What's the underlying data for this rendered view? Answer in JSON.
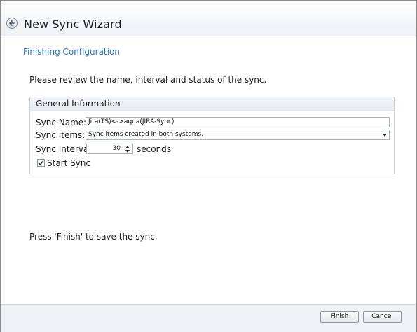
{
  "wizard": {
    "title": "New Sync Wizard",
    "subtitle": "Finishing Configuration",
    "instructions": "Please review the name, interval and status of the sync.",
    "finish_hint": "Press 'Finish' to save the sync."
  },
  "group": {
    "title": "General Information",
    "sync_name_label": "Sync Name:",
    "sync_name_value": "Jira(TS)<->aqua(JIRA-Sync)",
    "sync_items_label": "Sync Items:",
    "sync_items_value": "Sync items created in both systems.",
    "sync_interval_label": "Sync Interval:",
    "sync_interval_value": "30",
    "sync_interval_unit": "seconds",
    "start_sync_label": "Start Sync",
    "start_sync_checked": true
  },
  "footer": {
    "finish_label": "Finish",
    "cancel_label": "Cancel"
  },
  "icons": {
    "back": "back-arrow-icon",
    "dropdown": "chevron-down-icon",
    "spinner": "spinner-arrows-icon",
    "check": "checkmark-icon"
  },
  "colors": {
    "subtitle": "#2b72c3",
    "border": "#8d8d8d"
  }
}
